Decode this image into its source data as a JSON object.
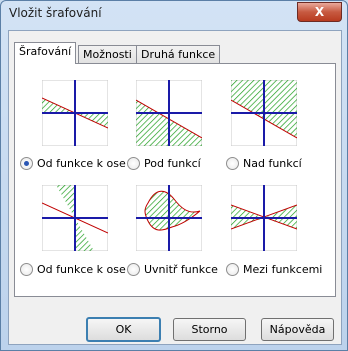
{
  "window": {
    "title": "Vložit šrafování",
    "close_glyph": "X"
  },
  "tabs": [
    {
      "label": "Šrafování"
    },
    {
      "label": "Možnosti"
    },
    {
      "label": "Druhá funkce"
    }
  ],
  "options": [
    {
      "label": "Od funkce k ose x",
      "icon": "hatch-between-function-and-x-axis-icon",
      "checked": true
    },
    {
      "label": "Pod funkcí",
      "icon": "hatch-below-function-icon",
      "checked": false
    },
    {
      "label": "Nad funkcí",
      "icon": "hatch-above-function-icon",
      "checked": false
    },
    {
      "label": "Od funkce k ose y",
      "icon": "hatch-between-function-and-y-axis-icon",
      "checked": false
    },
    {
      "label": "Uvnitř funkce",
      "icon": "hatch-inside-function-icon",
      "checked": false
    },
    {
      "label": "Mezi funkcemi",
      "icon": "hatch-between-functions-icon",
      "checked": false
    }
  ],
  "buttons": {
    "ok": "OK",
    "cancel": "Storno",
    "help": "Nápověda"
  },
  "colors": {
    "axis": "#1a1aa8",
    "curve": "#c00000",
    "hatch": "#1e9e1e",
    "grid": "#c8c8c8"
  }
}
